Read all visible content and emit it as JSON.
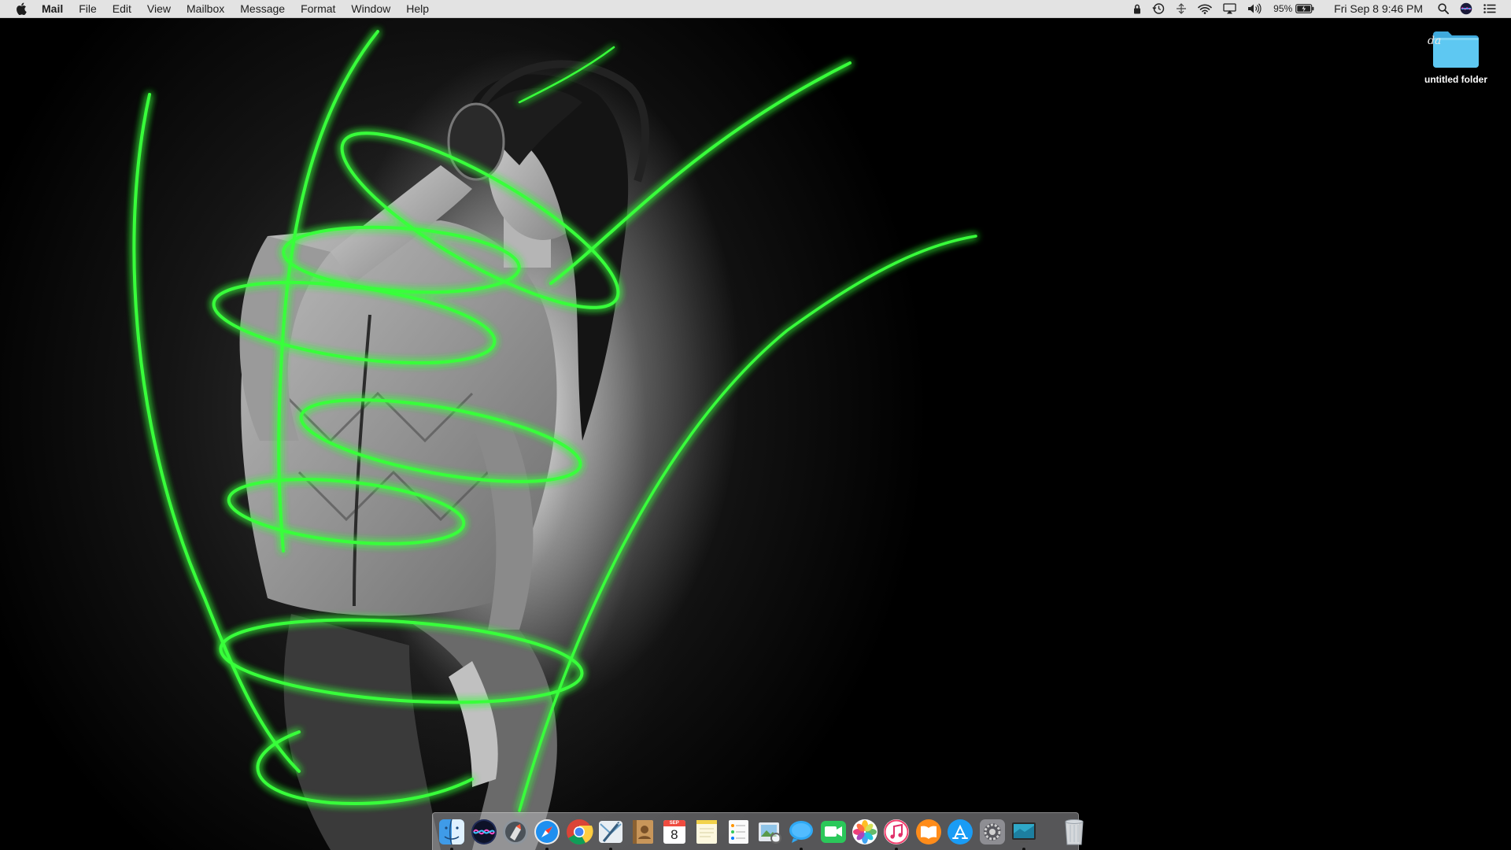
{
  "menubar": {
    "apple": "apple-logo",
    "app_name": "Mail",
    "menus": [
      "File",
      "Edit",
      "View",
      "Mailbox",
      "Message",
      "Format",
      "Window",
      "Help"
    ],
    "status": {
      "icons": [
        "lock-icon",
        "time-machine-icon",
        "sync-icon",
        "wifi-icon",
        "airplay-icon",
        "volume-icon"
      ],
      "battery_percent": "95%",
      "battery_icon": "battery-charging-icon",
      "clock": "Fri Sep 8  9:46 PM",
      "right_icons": [
        "spotlight-search-icon",
        "siri-icon",
        "notification-center-icon"
      ]
    }
  },
  "desktop": {
    "folder": {
      "label": "untitled folder",
      "tag_text": "da",
      "color": "#5ec8f2"
    }
  },
  "dock": {
    "apps": [
      {
        "name": "Finder",
        "icon": "finder-icon",
        "running": true
      },
      {
        "name": "Siri",
        "icon": "siri-icon",
        "running": false
      },
      {
        "name": "Launchpad",
        "icon": "launchpad-icon",
        "running": false
      },
      {
        "name": "Safari",
        "icon": "safari-icon",
        "running": true
      },
      {
        "name": "Google Chrome",
        "icon": "chrome-icon",
        "running": false
      },
      {
        "name": "Mail",
        "icon": "mail-icon",
        "running": true
      },
      {
        "name": "Contacts",
        "icon": "contacts-icon",
        "running": false
      },
      {
        "name": "Calendar",
        "icon": "calendar-icon",
        "running": false,
        "month": "SEP",
        "day": "8"
      },
      {
        "name": "Notes",
        "icon": "notes-icon",
        "running": false
      },
      {
        "name": "Reminders",
        "icon": "reminders-icon",
        "running": false
      },
      {
        "name": "Preview",
        "icon": "preview-icon",
        "running": false
      },
      {
        "name": "Messages",
        "icon": "messages-icon",
        "running": true
      },
      {
        "name": "FaceTime",
        "icon": "facetime-icon",
        "running": false
      },
      {
        "name": "Photos",
        "icon": "photos-icon",
        "running": false
      },
      {
        "name": "iTunes",
        "icon": "itunes-icon",
        "running": true
      },
      {
        "name": "iBooks",
        "icon": "ibooks-icon",
        "running": false
      },
      {
        "name": "App Store",
        "icon": "app-store-icon",
        "running": false
      },
      {
        "name": "System Preferences",
        "icon": "system-preferences-icon",
        "running": false
      },
      {
        "name": "Screen Sharing",
        "icon": "screen-sharing-icon",
        "running": true
      }
    ],
    "trash": {
      "name": "Trash",
      "icon": "trash-icon"
    }
  },
  "colors": {
    "glow_green": "#39ff3a",
    "menubar_bg": "#ececec",
    "folder_blue": "#5ec8f2"
  }
}
